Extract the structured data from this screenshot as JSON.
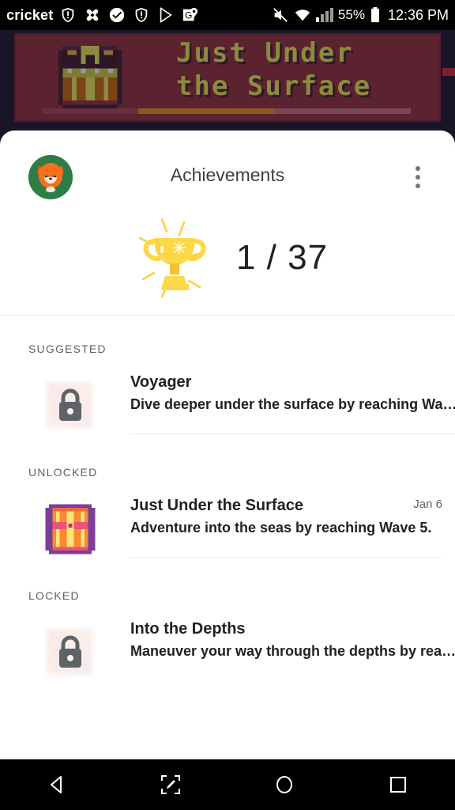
{
  "status_bar": {
    "carrier": "cricket",
    "battery_percent": "55%",
    "clock": "12:36 PM",
    "icons": [
      "warning-shield-icon",
      "photos-pinwheel-icon",
      "check-circle-icon",
      "warning-shield-icon",
      "play-store-icon",
      "google-maps-pin-icon",
      "mute-icon",
      "wifi-icon",
      "signal-bars-icon",
      "battery-icon"
    ]
  },
  "game_banner": {
    "title_line1": "Just Under",
    "title_line2": "the Surface",
    "icon": "pixel-treasure-chest-icon",
    "background_color": "#5b2230",
    "text_color": "#8d8a3e"
  },
  "sheet": {
    "title": "Achievements",
    "avatar": "fox-avatar",
    "overflow_menu": "more-options-icon",
    "summary": {
      "trophy_icon": "trophy-icon",
      "count": "1 / 37",
      "unlocked": 1,
      "total": 37
    }
  },
  "sections": [
    {
      "label": "SUGGESTED",
      "items": [
        {
          "badge": "lock-icon",
          "state": "locked",
          "name": "Voyager",
          "description": "Dive deeper under the surface by reaching Wa…",
          "date": ""
        }
      ]
    },
    {
      "label": "UNLOCKED",
      "items": [
        {
          "badge": "pixel-treasure-chest-icon",
          "state": "unlocked",
          "name": "Just Under the Surface",
          "description": "Adventure into the seas by reaching Wave 5.",
          "date": "Jan 6"
        }
      ]
    },
    {
      "label": "LOCKED",
      "items": [
        {
          "badge": "lock-icon",
          "state": "locked",
          "name": "Into the Depths",
          "description": "Maneuver your way through the depths by rea…",
          "date": ""
        }
      ]
    }
  ],
  "nav_bar": {
    "back": "back-icon",
    "screenshot": "screenshot-edit-icon",
    "home": "home-icon",
    "recents": "recents-icon"
  }
}
